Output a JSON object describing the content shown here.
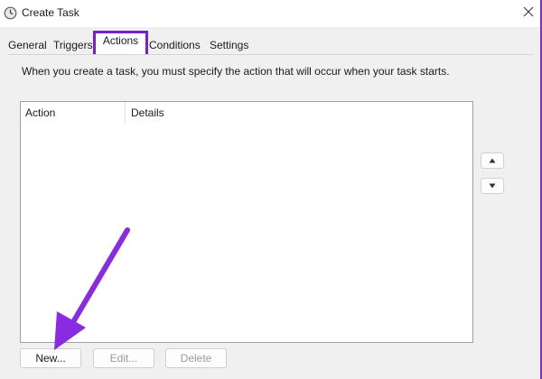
{
  "window": {
    "title": "Create Task",
    "title_icon": "clock-icon",
    "close_icon": "close-icon"
  },
  "tabs": [
    {
      "label": "General",
      "active": false
    },
    {
      "label": "Triggers",
      "active": false
    },
    {
      "label": "Actions",
      "active": true
    },
    {
      "label": "Conditions",
      "active": false
    },
    {
      "label": "Settings",
      "active": false
    }
  ],
  "actions_panel": {
    "description": "When you create a task, you must specify the action that will occur when your task starts.",
    "columns": [
      "Action",
      "Details"
    ],
    "rows": [],
    "move_up_icon": "triangle-up-icon",
    "move_down_icon": "triangle-down-icon"
  },
  "buttons": {
    "new_label": "New...",
    "edit_label": "Edit...",
    "delete_label": "Delete"
  },
  "colors": {
    "highlight": "#7a1fd0",
    "arrow": "#8a2be2"
  }
}
